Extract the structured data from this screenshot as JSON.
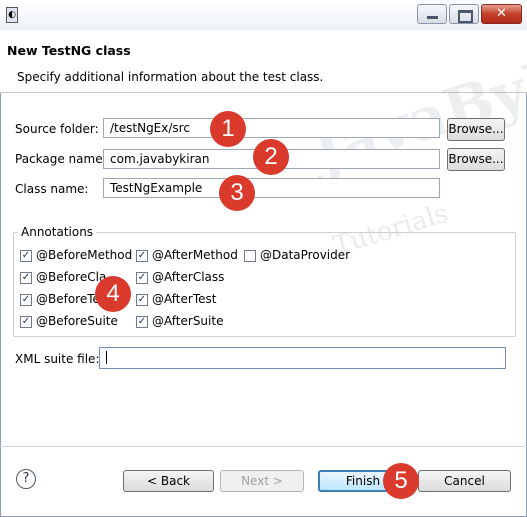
{
  "window": {
    "minimize_glyph": "",
    "close_glyph": "✕"
  },
  "header": {
    "title": "New TestNG class",
    "description": "Specify additional information about the test class."
  },
  "form": {
    "source_folder_label": "Source folder:",
    "source_folder_value": "/testNgEx/src",
    "package_name_label": "Package name:",
    "package_name_value": "com.javabykiran",
    "class_name_label": "Class name:",
    "class_name_value": "TestNgExample",
    "browse_label": "Browse..."
  },
  "annotations": {
    "title": "Annotations",
    "items": [
      {
        "label": "@BeforeMethod",
        "checked": true
      },
      {
        "label": "@AfterMethod",
        "checked": true
      },
      {
        "label": "@DataProvider",
        "checked": false
      },
      {
        "label": "@BeforeCla",
        "checked": true
      },
      {
        "label": "@AfterClass",
        "checked": true
      },
      {
        "label": "@BeforeTe",
        "checked": true
      },
      {
        "label": "@AfterTest",
        "checked": true
      },
      {
        "label": "@BeforeSuite",
        "checked": true
      },
      {
        "label": "@AfterSuite",
        "checked": true
      }
    ]
  },
  "xml": {
    "label": "XML suite file:",
    "value": ""
  },
  "footer": {
    "help_glyph": "?",
    "back_label": "< Back",
    "next_label": "Next >",
    "finish_label": "Finish",
    "cancel_label": "Cancel"
  },
  "callouts": [
    "1",
    "2",
    "3",
    "4",
    "5"
  ],
  "watermark": {
    "line1": "JavaByKiran",
    "line2": "Tutorials"
  },
  "colors": {
    "callout": "#d93a2b",
    "close_button": "#c4402c",
    "finish_border": "#3c7fb1"
  }
}
